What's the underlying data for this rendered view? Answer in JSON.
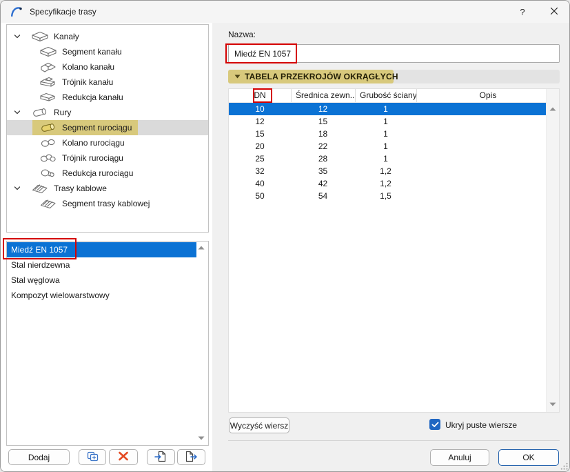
{
  "window": {
    "title": "Specyfikacje trasy",
    "help_label": "?"
  },
  "colors": {
    "selection_blue": "#0b72d4",
    "highlight_khaki": "#d8c97c",
    "annotation_red": "#d40000",
    "checkbox_blue": "#1f66c2",
    "delete_red": "#e44a22",
    "icon_blue": "#2a6bc9",
    "right_pane_bg": "#f0f0f0"
  },
  "tree": {
    "items": [
      {
        "label": "Kanały",
        "level": 0,
        "icon": "duct-segment",
        "expanded": true
      },
      {
        "label": "Segment kanału",
        "level": 1,
        "icon": "duct-segment"
      },
      {
        "label": "Kolano kanału",
        "level": 1,
        "icon": "duct-elbow"
      },
      {
        "label": "Trójnik kanału",
        "level": 1,
        "icon": "duct-tee"
      },
      {
        "label": "Redukcja kanału",
        "level": 1,
        "icon": "duct-reducer"
      },
      {
        "label": "Rury",
        "level": 0,
        "icon": "pipe-segment",
        "expanded": true
      },
      {
        "label": "Segment rurociągu",
        "level": 1,
        "icon": "pipe-segment",
        "selected": true
      },
      {
        "label": "Kolano rurociągu",
        "level": 1,
        "icon": "pipe-elbow"
      },
      {
        "label": "Trójnik rurociągu",
        "level": 1,
        "icon": "pipe-tee"
      },
      {
        "label": "Redukcja rurociągu",
        "level": 1,
        "icon": "pipe-reducer"
      },
      {
        "label": "Trasy kablowe",
        "level": 0,
        "icon": "cable-tray",
        "expanded": true
      },
      {
        "label": "Segment trasy kablowej",
        "level": 1,
        "icon": "cable-tray"
      }
    ]
  },
  "materials": {
    "items": [
      {
        "label": "Miedź EN 1057",
        "selected": true,
        "annotated": true
      },
      {
        "label": "Stal nierdzewna"
      },
      {
        "label": "Stal węglowa"
      },
      {
        "label": "Kompozyt wielowarstwowy"
      }
    ]
  },
  "left_buttons": {
    "add_label": "Dodaj",
    "icon_buttons": [
      "duplicate",
      "delete",
      "import",
      "export"
    ]
  },
  "name_field": {
    "label": "Nazwa:",
    "value": "Miedź EN 1057"
  },
  "section": {
    "title": "TABELA PRZEKROJÓW OKRĄGŁYCH",
    "collapsed": false
  },
  "table": {
    "columns": [
      "DN",
      "Średnica zewn...",
      "Grubość ściany",
      "Opis"
    ],
    "rows": [
      [
        "10",
        "12",
        "1",
        ""
      ],
      [
        "12",
        "15",
        "1",
        ""
      ],
      [
        "15",
        "18",
        "1",
        ""
      ],
      [
        "20",
        "22",
        "1",
        ""
      ],
      [
        "25",
        "28",
        "1",
        ""
      ],
      [
        "32",
        "35",
        "1,2",
        ""
      ],
      [
        "40",
        "42",
        "1,2",
        ""
      ],
      [
        "50",
        "54",
        "1,5",
        ""
      ]
    ],
    "selected_row_index": 0
  },
  "table_footer": {
    "clear_label": "Wyczyść wiersz",
    "checkbox_label": "Ukryj puste wiersze",
    "checkbox_checked": true
  },
  "footer": {
    "cancel_label": "Anuluj",
    "ok_label": "OK"
  }
}
